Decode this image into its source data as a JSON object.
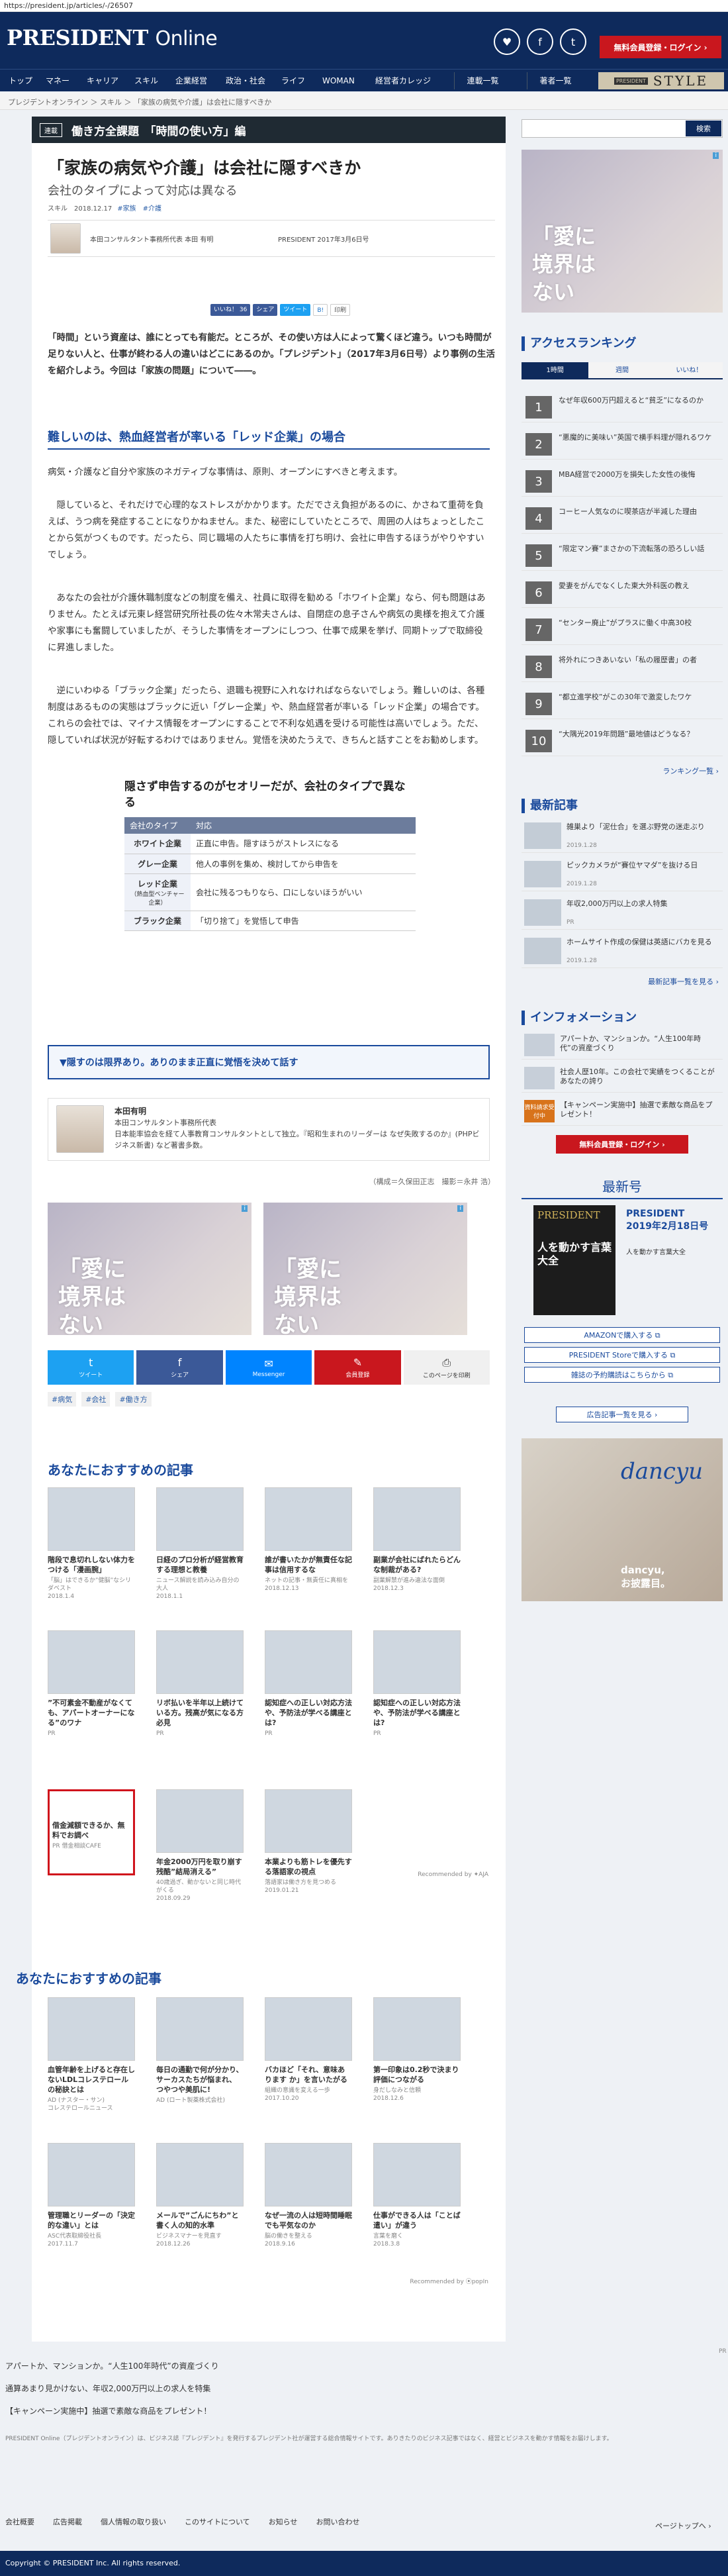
{
  "url": "https://president.jp/articles/-/26507",
  "header": {
    "logo_main": "PRESIDENT",
    "logo_sub": "Online",
    "social": [
      "♥",
      "f",
      "t"
    ],
    "register": "無料会員登録・ログイン ›"
  },
  "nav": {
    "items": [
      "トップ",
      "マネー",
      "キャリア",
      "スキル",
      "企業経営",
      "政治・社会",
      "ライフ",
      "WOMAN",
      "経営者カレッジ"
    ],
    "buttons": [
      "連載一覧",
      "著者一覧"
    ],
    "style_small": "PRESIDENT",
    "style_big": "STYLE"
  },
  "breadcrumb": "プレジデントオンライン ＞ スキル ＞ 「家族の病気や介護」は会社に隠すべきか",
  "article": {
    "series_tag": "連載",
    "series_title": "働き方全課題　「時間の使い方」編",
    "title": "「家族の病気や介護」は会社に隠すべきか",
    "subtitle": "会社のタイプによって対応は異なる",
    "meta": "スキル　2018.12.17",
    "tags": "#家族　#介護",
    "author_line": "本田コンサルタント事務所代表 本田 有明",
    "issue": "PRESIDENT 2017年3月6日号",
    "share": [
      "いいね！ 36",
      "シェア",
      "ツイート",
      "B!",
      "印刷"
    ],
    "lead": "「時間」という資産は、誰にとっても有能だ。ところが、その使い方は人によって驚くほど違う。いつも時間が足りない人と、仕事が終わる人の違いはどこにあるのか。「プレジデント」（2017年3月6日号）より事例の生活を紹介しよう。今回は「家族の問題」について――。",
    "h2": "難しいのは、熱血経営者が率いる「レッド企業」の場合",
    "paras": [
      "病気・介護など自分や家族のネガティブな事情は、原則、オープンにすべきと考えます。",
      "隠していると、それだけで心理的なストレスがかかります。ただでさえ負担があるのに、かさねて重荷を負えば、うつ病を発症することになりかねません。また、秘密にしていたところで、周囲の人はちょっとしたことから気がつくものです。だったら、同じ職場の人たちに事情を打ち明け、会社に申告するほうがやりやすいでしょう。",
      "あなたの会社が介護休職制度などの制度を備え、社員に取得を勧める「ホワイト企業」なら、何も問題はありません。たとえば元東レ経営研究所社長の佐々木常夫さんは、自閉症の息子さんや病気の奥様を抱えて介護や家事にも奮闘していましたが、そうした事情をオープンにしつつ、仕事で成果を挙げ、同期トップで取締役に昇進しました。",
      "逆にいわゆる「ブラック企業」だったら、退職も視野に入れなければならないでしょう。難しいのは、各種制度はあるものの実態はブラックに近い「グレー企業」や、熱血経営者が率いる「レッド企業」の場合です。これらの会社では、マイナス情報をオープンにすることで不利な処遇を受ける可能性は高いでしょう。ただ、隠していれば状況が好転するわけではありません。覚悟を決めたうえで、きちんと話すことをお勧めします。"
    ],
    "table_title": "隠さず申告するのがセオリーだが、会社のタイプで異なる",
    "table_head": [
      "会社のタイプ",
      "対応"
    ],
    "table_rows": [
      {
        "k": "ホワイト企業",
        "v": "正直に申告。隠すほうがストレスになる",
        "k2": ""
      },
      {
        "k": "グレー企業",
        "v": "他人の事例を集め、検討してから申告を",
        "k2": ""
      },
      {
        "k": "レッド企業",
        "v": "会社に残るつもりなら、口にしないほうがいい",
        "k2": "（熱血型ベンチャー企業）"
      },
      {
        "k": "ブラック企業",
        "v": "「切り捨て」を覚悟して申告",
        "k2": ""
      }
    ],
    "link_box": "▼隠すのは限界あり。ありのまま正直に覚悟を決めて話す",
    "profile_name": "本田有明",
    "profile_text": "本田コンサルタント事務所代表\n日本能率協会を経て人事教育コンサルタントとして独立。『昭和生まれのリーダーは なぜ失敗するのか』(PHPビジネス新書) など著書多数。",
    "credit": "（構成＝久保田正志　撮影＝永井 浩）",
    "ad_text": "「愛に\n境界は\nない",
    "share_big": [
      {
        "i": "t",
        "l": "ツイート"
      },
      {
        "i": "f",
        "l": "シェア"
      },
      {
        "i": "✉",
        "l": "Messenger"
      },
      {
        "i": "✎",
        "l": "会員登録"
      },
      {
        "i": "⎙",
        "l": "このページを印刷"
      }
    ],
    "tags_bottom": [
      "#病気",
      "#会社",
      "#働き方"
    ]
  },
  "rec1": {
    "title": "あなたにおすすめの記事",
    "cards": [
      {
        "t": "階段で息切れしない体力をつける「漫画腕」",
        "d": "「脳」はできるか”健脳”なシリダベスト\n2018.1.4"
      },
      {
        "t": "日経のプロ分析が経営教育する理想と教養",
        "d": "ニュース解説を読み込み自分の大人\n2018.1.1"
      },
      {
        "t": "誰が書いたかが無責任な記事は信用するな",
        "d": "ネットの記事・無責任に真相を\n2018.12.13"
      },
      {
        "t": "副業が会社にばれたらどんな制裁がある?",
        "d": "副業解禁が進み違法な面倒\n2018.12.3"
      },
      {
        "t": "”不可素金不動産がなくても、アパートオーナーになる”のワナ",
        "d": "PR"
      },
      {
        "t": "リボ払いを半年以上続けている方。残高が気になる方必見",
        "d": "PR"
      },
      {
        "t": "認知症への正しい対応方法や、予防法が学べる講座とは?",
        "d": "PR"
      },
      {
        "t": "認知症への正しい対応方法や、予防法が学べる講座とは?",
        "d": "PR"
      },
      {
        "t": "借金減額できるか、無料でお調べ",
        "d": "PR 借金相談CAFE"
      },
      {
        "t": "年金2000万円を取り崩す残酷”結局消える”",
        "d": "40歳過ぎ、動かないと同じ時代がくる\n2018.09.29"
      },
      {
        "t": "本業よりも筋トレを優先する落語家の視点",
        "d": "落語家は働き方を見つめる\n2019.01.21"
      }
    ],
    "credit": "Recommended by ✦AJA"
  },
  "rec2": {
    "title": "あなたにおすすめの記事",
    "cards": [
      {
        "t": "血管年齢を上げると存在しないLDLコレステロールの秘訣とは",
        "d": "AD (ナスター・サン)\nコレステロールニュース"
      },
      {
        "t": "毎日の通勤で何が分かり、サーカスたちが悩まれ、つやつや美肌に!",
        "d": "AD (ロート製薬株式会社)"
      },
      {
        "t": "バカほど「それ、意味あります か」を言いたがる",
        "d": "組織の意識を変える一歩\n2017.10.20"
      },
      {
        "t": "第一印象は0.2秒で決まり評価につながる",
        "d": "身だしなみと信頼\n2018.12.6"
      },
      {
        "t": "管理職とリーダーの「決定的な違い」とは",
        "d": "ASC代表取締役社長\n2017.11.7"
      },
      {
        "t": "メールで”ごんにちわ”と書く人の知的水準",
        "d": "ビジネスマナーを見直す\n2018.12.26"
      },
      {
        "t": "なぜ一流の人は短時間睡眠でも平気なのか",
        "d": "脳の働きを整える\n2018.9.16"
      },
      {
        "t": "仕事ができる人は「ことば遣い」が違う",
        "d": "言葉を磨く\n2018.3.8"
      }
    ],
    "credit": "Recommended by ⦿popIn"
  },
  "sidebar": {
    "search_label": "検索",
    "ad_text": "「愛に\n境界は\nない",
    "rank_title": "アクセスランキング",
    "rank_tabs": [
      "1時間",
      "週間",
      "いいね！"
    ],
    "rank": [
      "なぜ年収600万円超えると“貧乏”になるのか",
      "“悪魔的に美味い”英国で横手料理が隠れるワケ",
      "MBA経営で2000万を損失した女性の後悔",
      "コーヒー人気なのに喫茶店が半減した理由",
      "“限定マン賽”まさかの下流転落の恐ろしい話",
      "愛妻をがんでなくした東大外科医の教え",
      "“センター廃止”がプラスに働く中高30校",
      "将外れにつきあいない「私の履歴書」の者",
      "“都立進学校”がこの30年で激変したワケ",
      "“大隅光2019年問題”最地値はどうなる？"
    ],
    "rank_more": "ランキング一覧 ›",
    "news_title": "最新記事",
    "news": [
      {
        "t": "雑巣より「泥仕合」を選ぶ野党の迷走ぶり",
        "d": "2019.1.28"
      },
      {
        "t": "ピックカメラが“賽位ヤマダ”を抜ける日",
        "d": "2019.1.28"
      },
      {
        "t": "年収2,000万円以上の求人特集",
        "d": "PR"
      },
      {
        "t": "ホームサイト作成の保健は英語にバカを見る",
        "d": "2019.1.28"
      }
    ],
    "news_more": "最新記事一覧を見る ›",
    "info_title": "インフォメーション",
    "info": [
      "アパートか、マンションか。“人生100年時代”の資産づくり",
      "社会人歴10年。この会社で実績をつくることがあなたの誇り",
      "【キャンペーン実施中】抽選で素敵な商品をプレゼント！"
    ],
    "info_red": "資料請求受付中",
    "login_btn": "無料会員登録・ログイン ›",
    "mag_title": "最新号",
    "mag_name": "PRESIDENT",
    "mag_date": "2019年2月18日号",
    "mag_cover": "人を動かす言葉大全",
    "mag_sub": "人を動かす言葉大全",
    "mag_buttons": [
      "AMAZONで購入する ⧉",
      "PRESIDENT Storeで購入する ⧉",
      "雑誌の予約購読はこちらから ⧉"
    ],
    "ad_list_btn": "広告記事一覧を見る ›",
    "dancyu_logo": "dancyu",
    "dancyu_text": "dancyu,\nお披露目。"
  },
  "footer_ad_label": "PR",
  "footer_items": [
    "アパートか、マンションか。“人生100年時代”の資産づくり",
    "通算あまり見かけない、年収2,000万円以上の求人を特集",
    "【キャンペーン実施中】抽選で素敵な商品をプレゼント！"
  ],
  "footer_desc": "PRESIDENT Online（プレジデントオンライン）は、ビジネス誌『プレジデント』を発行するプレジデント社が運営する総合情報サイトです。ありきたりのビジネス記事ではなく、経営とビジネスを動かす情報をお届けします。",
  "footer_links": [
    "会社概要",
    "広告掲載",
    "個人情報の取り扱い",
    "このサイトについて",
    "お知らせ",
    "お問い合わせ"
  ],
  "page_top": "ページトップへ ›",
  "copyright": "Copyright © PRESIDENT Inc. All rights reserved."
}
